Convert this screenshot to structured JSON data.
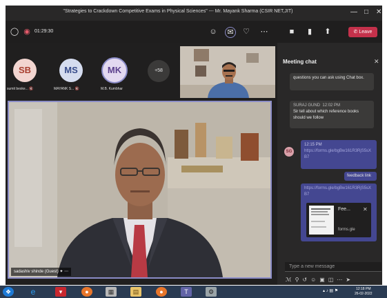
{
  "window": {
    "title": "\"Strategies to Crackdown Competitive Exams in Physical Sciences\" --- Mr. Mayank Sharma (CSIR NET,JIT)",
    "minimize_icon": "minimize-icon",
    "maximize_icon": "maximize-icon",
    "close_icon": "close-icon"
  },
  "toolbar": {
    "timer": "01:29:30",
    "leave_label": "Leave",
    "icons": [
      "shield-icon",
      "record-icon",
      "participants-icon",
      "chat-icon",
      "reactions-icon",
      "more-icon",
      "camera-icon",
      "mic-icon",
      "share-icon",
      "phone-icon"
    ]
  },
  "participants": [
    {
      "initials": "SB",
      "name": "sumit beske...",
      "bg": "#f2d5d0",
      "fg": "#a83f2f"
    },
    {
      "initials": "MS",
      "name": "MAYANK S...",
      "bg": "#d5dcef",
      "fg": "#374b8a"
    },
    {
      "initials": "MK",
      "name": "M.B. Kumbhar",
      "bg": "#e3d9f0",
      "fg": "#5b3f8c"
    }
  ],
  "overflow_count": "+58",
  "main_video": {
    "name": "sadashiv shinde (Guest)"
  },
  "chat": {
    "title": "Meeting chat",
    "messages": [
      {
        "text": "questions you can ask using Chat box."
      },
      {
        "author": "SURAJ GUND",
        "time": "12:02 PM",
        "initials": "SG",
        "text": "Sir tell about which reference books should we follow"
      },
      {
        "time": "12:15 PM",
        "link": "https://forms.gle/bgBw161R3RjS5sXB7"
      },
      {
        "text": "feedback link"
      },
      {
        "link": "https://forms.gle/bgBw161R3RjS5sXB7",
        "preview_title": "Fee...",
        "preview_domain": "forms.gle"
      }
    ],
    "input_placeholder": "Type a new message"
  },
  "taskbar": {
    "time": "12:18 PM",
    "date": "26-02-2022"
  },
  "colors": {
    "accent": "#6264a7",
    "leave": "#c4314b",
    "chat_bg": "#292828",
    "my_bubble": "#444791"
  }
}
